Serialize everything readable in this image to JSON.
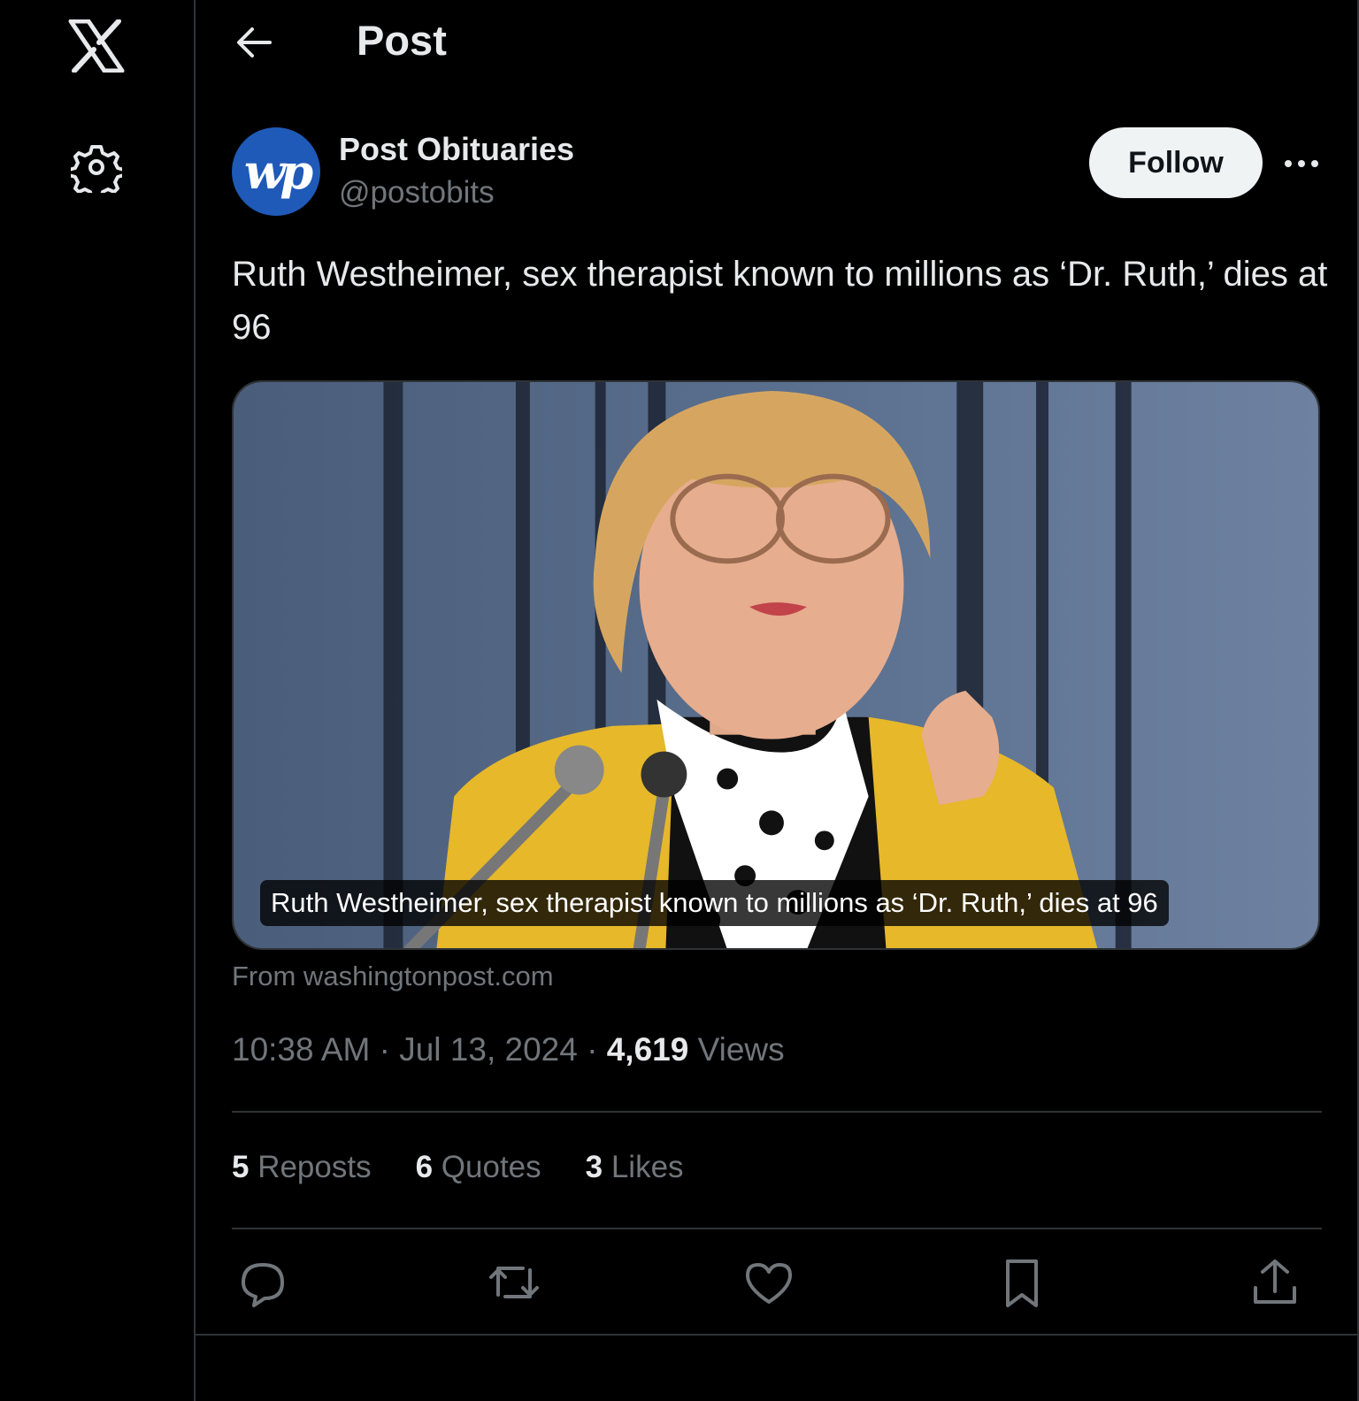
{
  "header": {
    "title": "Post"
  },
  "author": {
    "name": "Post Obituaries",
    "handle": "@postobits",
    "avatar_text": "wp"
  },
  "follow_label": "Follow",
  "post": {
    "text": "Ruth Westheimer, sex therapist known to millions as ‘Dr. Ruth,’ dies at 96",
    "card_caption": "Ruth Westheimer, sex therapist known to millions as ‘Dr. Ruth,’ dies at 96",
    "source": "From washingtonpost.com"
  },
  "meta": {
    "time": "10:38 AM",
    "sep1": " · ",
    "date": "Jul 13, 2024",
    "sep2": " · ",
    "views_count": "4,619",
    "views_label": " Views"
  },
  "stats": {
    "reposts_count": "5",
    "reposts_label": " Reposts",
    "quotes_count": "6",
    "quotes_label": " Quotes",
    "likes_count": "3",
    "likes_label": " Likes"
  },
  "icons": [
    "x-logo-icon",
    "gear-icon",
    "back-arrow-icon",
    "more-icon",
    "reply-icon",
    "repost-icon",
    "like-icon",
    "bookmark-icon",
    "share-icon"
  ],
  "colors": {
    "background": "#000000",
    "text": "#e7e9ea",
    "muted": "#71767b",
    "border": "#2f3336",
    "avatar_bg": "#1f5ab8"
  }
}
